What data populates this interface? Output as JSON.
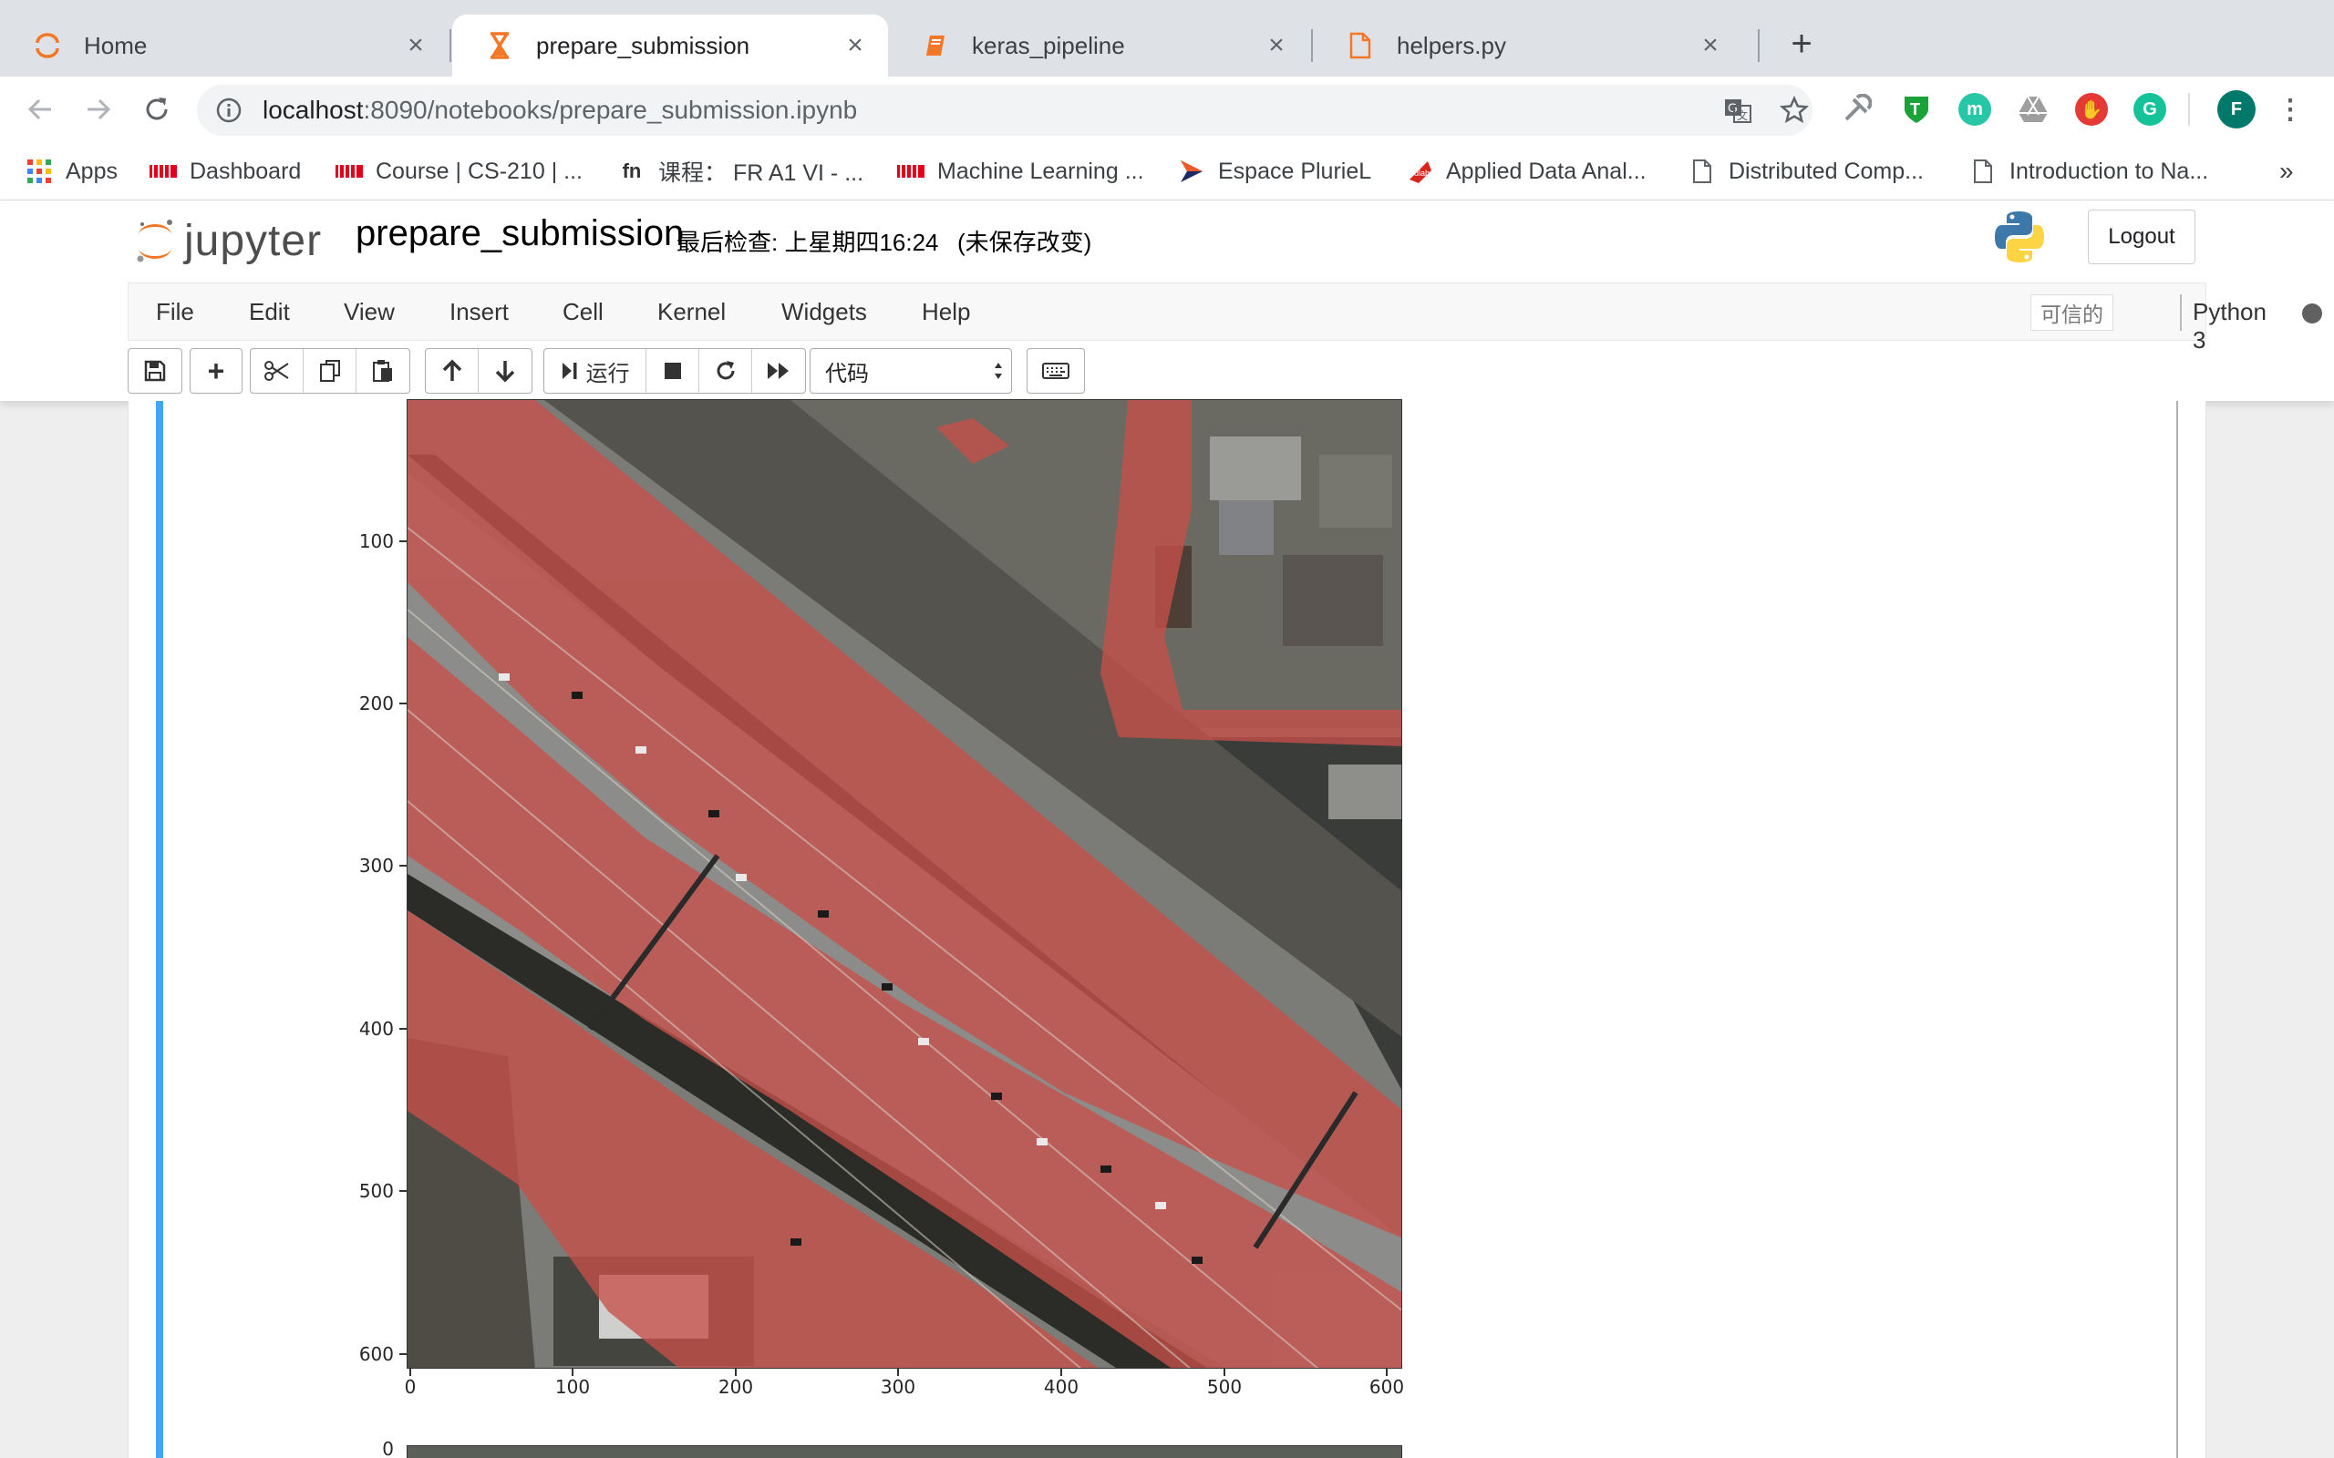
{
  "browser": {
    "tabs": [
      {
        "title": "Home",
        "icon": "jupyter-icon"
      },
      {
        "title": "prepare_submission",
        "icon": "hourglass-icon"
      },
      {
        "title": "keras_pipeline",
        "icon": "notebook-icon"
      },
      {
        "title": "helpers.py",
        "icon": "file-icon"
      }
    ],
    "url_host": "localhost",
    "url_path": ":8090/notebooks/prepare_submission.ipynb",
    "profile_initial": "F",
    "bookmarks": [
      {
        "label": "Apps",
        "icon": "apps-grid-icon"
      },
      {
        "label": "Dashboard",
        "icon": "epfl-icon"
      },
      {
        "label": "Course | CS-210 | ...",
        "icon": "epfl-icon"
      },
      {
        "label": "课程： FR A1 VI - ...",
        "icon": "fun-icon"
      },
      {
        "label": "Machine Learning ...",
        "icon": "epfl-icon"
      },
      {
        "label": "Espace PlurieL",
        "icon": "arrow-icon"
      },
      {
        "label": "Applied Data Anal...",
        "icon": "ada-icon"
      },
      {
        "label": "Distributed Comp...",
        "icon": "page-icon"
      },
      {
        "label": "Introduction to Na...",
        "icon": "page-icon"
      }
    ],
    "more_bookmarks": "»"
  },
  "jupyter": {
    "logo_text": "jupyter",
    "notebook_title": "prepare_submission",
    "checkpoint": "最后检查: 上星期四16:24",
    "unsaved": "(未保存改变)",
    "logout": "Logout",
    "menu": [
      "File",
      "Edit",
      "View",
      "Insert",
      "Cell",
      "Kernel",
      "Widgets",
      "Help"
    ],
    "trusted": "可信的",
    "kernel": "Python 3",
    "run_label": "运行",
    "cell_type": "代码"
  },
  "plot": {
    "yticks": [
      "100",
      "200",
      "300",
      "400",
      "500",
      "600"
    ],
    "xticks": [
      "0",
      "100",
      "200",
      "300",
      "400",
      "500",
      "600"
    ],
    "next_plot_ytick": "0"
  },
  "colors": {
    "cell_selected": "#42a5f5",
    "overlay_road": "#c8504a",
    "jupyter_orange": "#f37726"
  }
}
